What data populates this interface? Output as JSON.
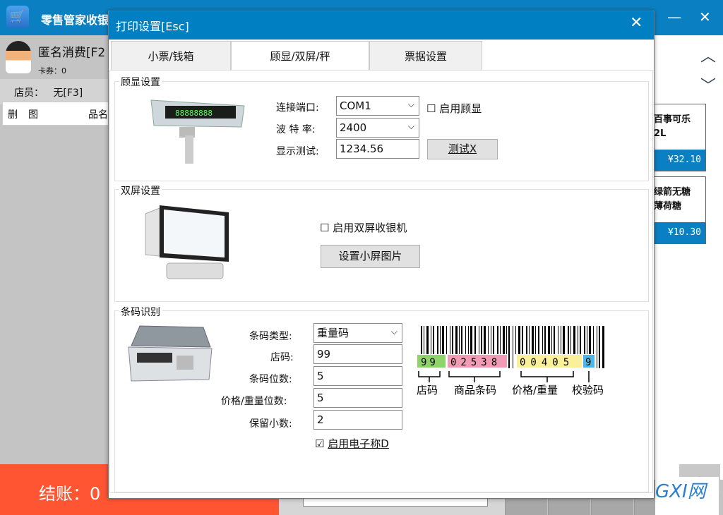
{
  "app": {
    "title": "零售管家收银",
    "logo_icon": "cart-icon",
    "minimize_icon": "minimize-icon",
    "close_icon": "close-icon"
  },
  "member": {
    "name": "匿名消费[F2",
    "coupon": "卡券：0",
    "staff_label": "店员：",
    "staff_value": "无[F3]"
  },
  "grid": {
    "columns": [
      "删",
      "图",
      "品名"
    ]
  },
  "pay": {
    "label": "结账：0"
  },
  "products": [
    {
      "name": "百事可乐2L",
      "line1": "百事可乐",
      "line2": "2L",
      "price": "¥32.10"
    },
    {
      "name": "绿箭无糖薄荷糖",
      "line1": "绿箭无糖",
      "line2": "薄荷糖",
      "price": "¥10.30"
    }
  ],
  "colors": {
    "brand": "#0a80c3",
    "pay": "#ff5533"
  },
  "dialog": {
    "title": "打印设置[Esc]",
    "tabs": [
      {
        "label": "小票/钱箱"
      },
      {
        "label": "顾显/双屏/秤",
        "active": true
      },
      {
        "label": "票据设置"
      }
    ],
    "display": {
      "group": "顾显设置",
      "port_label": "连接端口:",
      "port": "COM1",
      "baud_label": "波 特 率:",
      "baud": "2400",
      "test_label": "显示测试:",
      "test_value": "1234.56",
      "test_button": "测试X",
      "enable": "启用顾显",
      "enable_checked": false
    },
    "dual": {
      "group": "双屏设置",
      "enable": "启用双屏收银机",
      "enable_checked": false,
      "image_button": "设置小屏图片"
    },
    "barcode": {
      "group": "条码识别",
      "type_label": "条码类型:",
      "type": "重量码",
      "store_label": "店码:",
      "store": "99",
      "digits_label": "条码位数:",
      "digits": "5",
      "price_digits_label": "价格/重量位数:",
      "price_digits": "5",
      "decimals_label": "保留小数:",
      "decimals": "2",
      "scale": "启用电子称D",
      "scale_checked": true,
      "sample": {
        "store": "99",
        "product": "02538",
        "price": "00405",
        "check": "9",
        "store_caption": "店码",
        "product_caption": "商品条码",
        "price_caption": "价格/重量",
        "check_caption": "校验码"
      }
    }
  }
}
